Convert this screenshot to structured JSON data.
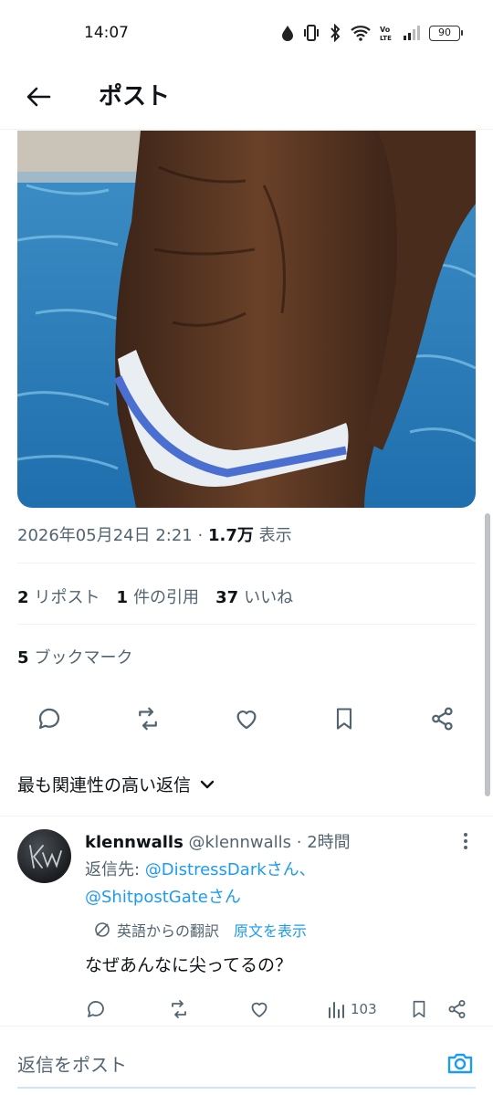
{
  "status_bar": {
    "time": "14:07",
    "battery": "90",
    "icons": [
      "data-drop-icon",
      "vibrate-icon",
      "bluetooth-icon",
      "wifi-icon",
      "volte-icon",
      "signal-icon",
      "battery-icon"
    ]
  },
  "header": {
    "title": "ポスト",
    "back_icon": "arrow-left-icon"
  },
  "post": {
    "image_description_only": "",
    "timestamp": "2026年05月24日 2:21",
    "separator": "·",
    "views_count": "1.7万",
    "views_label": "表示",
    "reposts_count": "2",
    "reposts_label": "リポスト",
    "quotes_count": "1",
    "quotes_label": "件の引用",
    "likes_count": "37",
    "likes_label": "いいね",
    "bookmarks_count": "5",
    "bookmarks_label": "ブックマーク",
    "actions": [
      "reply-icon",
      "repost-icon",
      "like-icon",
      "bookmark-icon",
      "share-icon"
    ]
  },
  "replies": {
    "sort_label": "最も関連性の高い返信",
    "items": [
      {
        "display_name": "klennwalls",
        "handle": "@klennwalls",
        "separator": "·",
        "time": "2時間",
        "reply_to_label": "返信先: ",
        "mention_1": "@DistressDarkさん、",
        "mention_2": "@ShitpostGateさん",
        "translated_from": "英語からの翻訳",
        "show_original": "原文を表示",
        "text": "なぜあんなに尖ってるの？",
        "views": "103"
      }
    ]
  },
  "composer": {
    "placeholder": "返信をポスト"
  },
  "colors": {
    "accent": "#1d9bf0",
    "text_primary": "#0f1419",
    "text_secondary": "#536471",
    "divider": "#eff3f4"
  }
}
